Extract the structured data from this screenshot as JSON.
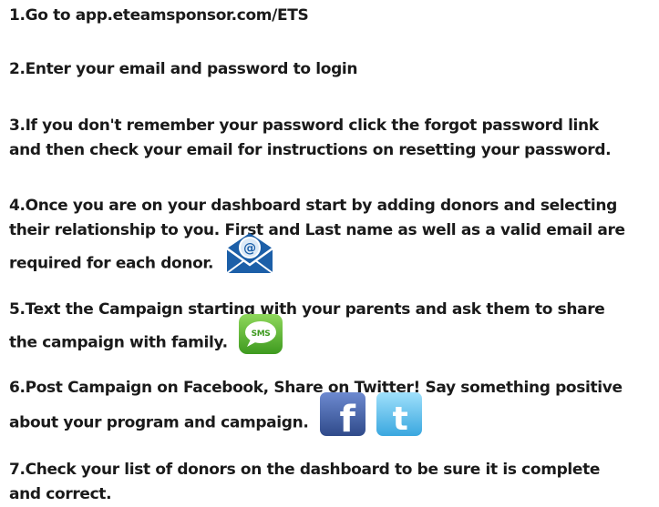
{
  "steps": [
    {
      "lines": [
        "1.Go to app.eteamsponsor.com/ETS"
      ]
    },
    {
      "lines": [
        "2.Enter your email and password to login"
      ]
    },
    {
      "lines": [
        "3.If you don't remember your password click the forgot password link",
        "and then check your email for instructions on resetting your password."
      ]
    },
    {
      "lines": [
        "4.Once you are on your dashboard start by adding donors and selecting",
        "their relationship to you.  First and Last name as well as a valid email are",
        "required for each donor."
      ],
      "icons": [
        "email-envelope-icon"
      ]
    },
    {
      "lines": [
        "5.Text the Campaign starting with your parents and ask them to share",
        "the campaign with family."
      ],
      "icons": [
        "sms-icon"
      ],
      "icon_text": "SMS"
    },
    {
      "lines": [
        "6.Post Campaign on Facebook, Share on Twitter! Say something positive",
        "about your program and campaign."
      ],
      "icons": [
        "facebook-icon",
        "twitter-icon"
      ],
      "icon_letters": [
        "f",
        "t"
      ]
    },
    {
      "lines": [
        "7.Check your list of donors on the dashboard to be sure it is complete",
        "and correct."
      ]
    }
  ],
  "colors": {
    "text": "#1a1a1a",
    "facebook": "#3b5998",
    "twitter": "#4fb6e8",
    "sms_green": "#4caf2a",
    "email_blue": "#1c5fa8"
  }
}
